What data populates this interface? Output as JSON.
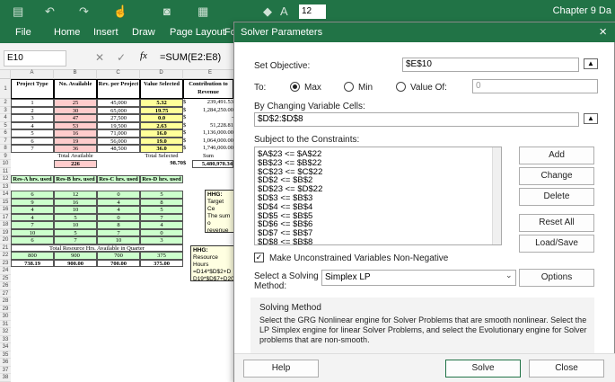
{
  "ribbon": {
    "font_size": "12",
    "title": "Chapter 9 Da",
    "tabs": [
      "File",
      "Home",
      "Insert",
      "Draw",
      "Page Layout",
      "Fo"
    ]
  },
  "formula_bar": {
    "name_box": "E10",
    "fx": "fx",
    "formula": "=SUM(E2:E8)"
  },
  "sheet": {
    "columns": [
      "A",
      "B",
      "C",
      "D",
      "E"
    ],
    "rows": [
      "1",
      "2",
      "3",
      "4",
      "5",
      "6",
      "7",
      "8",
      "9",
      "10",
      "11",
      "12",
      "13",
      "14",
      "15",
      "16",
      "17",
      "18",
      "19",
      "20",
      "21",
      "22",
      "23",
      "24",
      "25",
      "26",
      "27",
      "28",
      "29",
      "30",
      "31",
      "32",
      "33",
      "34",
      "35",
      "36",
      "37",
      "38"
    ],
    "header": [
      "Project Type",
      "No. Available",
      "Rev. per Project",
      "Value Selected",
      "Contribution to Revenue"
    ],
    "data": [
      [
        "1",
        "25",
        "45,000",
        "5.32",
        "$",
        "239,491.53"
      ],
      [
        "2",
        "30",
        "65,000",
        "19.75",
        "$",
        "1,284,250.00"
      ],
      [
        "3",
        "47",
        "27,500",
        "0.0",
        "$",
        "-"
      ],
      [
        "4",
        "53",
        "19,500",
        "2.63",
        "$",
        "51,228.81"
      ],
      [
        "5",
        "16",
        "71,000",
        "16.0",
        "$",
        "1,136,000.00"
      ],
      [
        "6",
        "19",
        "56,000",
        "19.0",
        "$",
        "1,064,000.00"
      ],
      [
        "7",
        "36",
        "48,500",
        "36.0",
        "$",
        "1,746,000.00"
      ]
    ],
    "row9": [
      "Total Available",
      "Total Selected",
      "Sum"
    ],
    "row10": [
      "226",
      "98.70",
      "$",
      "5,480,970.34"
    ],
    "hrs_header": [
      "Res-A hrs. used",
      "Res-B hrs. used",
      "Res-C hrs. used",
      "Res-D hrs. used"
    ],
    "hrs": [
      [
        "6",
        "12",
        "0",
        "5"
      ],
      [
        "9",
        "16",
        "4",
        "8"
      ],
      [
        "4",
        "10",
        "4",
        "5"
      ],
      [
        "4",
        "5",
        "0",
        "7"
      ],
      [
        "7",
        "10",
        "8",
        "4"
      ],
      [
        "10",
        "5",
        "7",
        "0"
      ],
      [
        "6",
        "7",
        "10",
        "3"
      ]
    ],
    "row21": "Total Resource Hrs. Available in Quarter",
    "row22": [
      "800",
      "900",
      "700",
      "375"
    ],
    "row23": [
      "738.19",
      "900.00",
      "700.00",
      "375.00"
    ],
    "note1": [
      "HHG:",
      "Target Ce",
      "The sum o",
      "revenue"
    ],
    "note2": [
      "HHG:",
      "Resource Hours",
      "=D14*$D$2+D",
      "D19*$D$7+D20"
    ]
  },
  "dialog": {
    "title": "Solver Parameters",
    "set_objective_label": "Set Objective:",
    "objective": "$E$10",
    "to_label": "To:",
    "max": "Max",
    "min": "Min",
    "value_of": "Value Of:",
    "value_of_input": "0",
    "changing_label": "By Changing Variable Cells:",
    "changing": "$D$2:$D$8",
    "constraints_label": "Subject to the Constraints:",
    "constraints": [
      "$A$23 <= $A$22",
      "$B$23 <= $B$22",
      "$C$23 <= $C$22",
      "$D$2 <= $B$2",
      "$D$23 <= $D$22",
      "$D$3 <= $B$3",
      "$D$4 <= $B$4",
      "$D$5 <= $B$5",
      "$D$6 <= $B$6",
      "$D$7 <= $B$7",
      "$D$8 <= $B$8"
    ],
    "add": "Add",
    "change": "Change",
    "delete": "Delete",
    "reset_all": "Reset All",
    "load_save": "Load/Save",
    "nonneg": "Make Unconstrained Variables Non-Negative",
    "method_label_1": "Select a Solving",
    "method_label_2": "Method:",
    "method": "Simplex LP",
    "options": "Options",
    "method_title": "Solving Method",
    "method_text": "Select the GRG Nonlinear engine for Solver Problems that are smooth nonlinear. Select the LP Simplex engine for linear Solver Problems, and select the Evolutionary engine for Solver problems that are non-smooth.",
    "help": "Help",
    "solve": "Solve",
    "close": "Close"
  },
  "colors": {
    "excel_green": "#217346",
    "yellow_fill": "#ffff99",
    "pink_fill": "#ffcccc",
    "green_fill": "#ccffcc"
  }
}
